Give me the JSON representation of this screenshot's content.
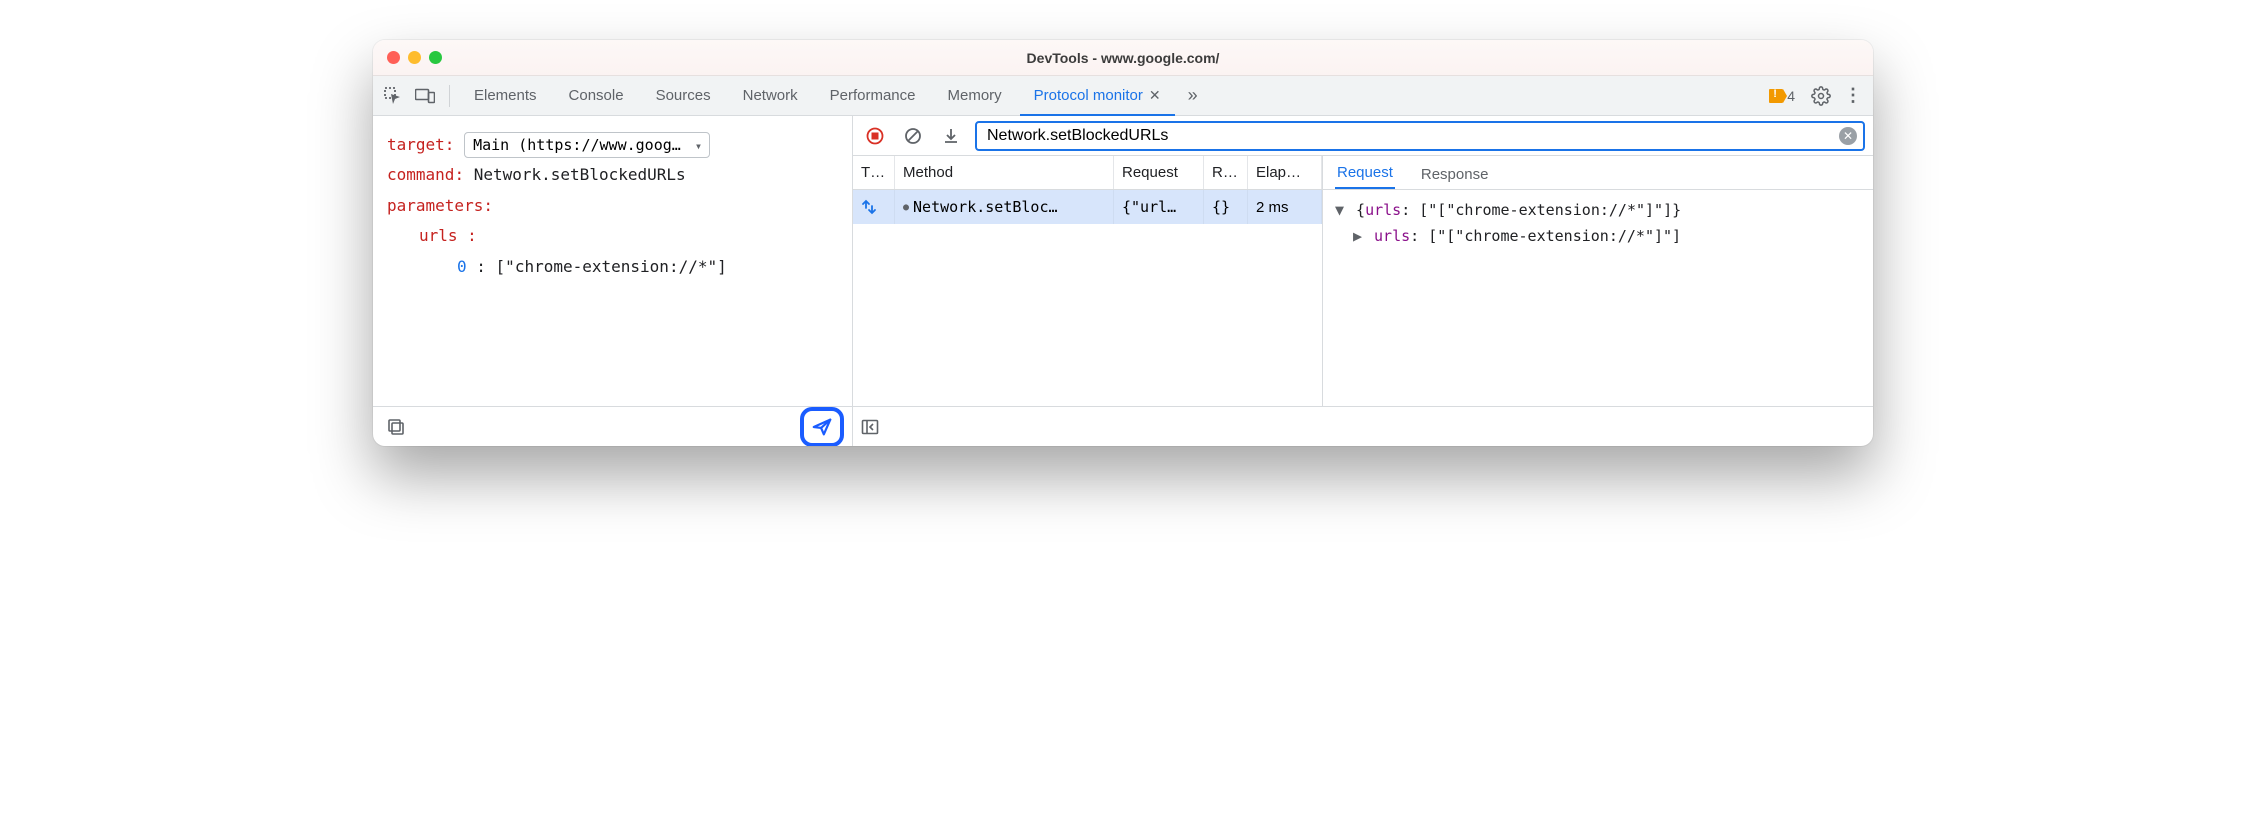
{
  "window": {
    "title": "DevTools - www.google.com/"
  },
  "tabs": {
    "items": [
      "Elements",
      "Console",
      "Sources",
      "Network",
      "Performance",
      "Memory",
      "Protocol monitor"
    ],
    "active_index": 6,
    "warning_count": "4"
  },
  "editor": {
    "target_label": "target",
    "target_value": "Main (https://www.goog…",
    "command_label": "command",
    "command_value": "Network.setBlockedURLs",
    "parameters_label": "parameters",
    "param_name": "urls",
    "param_index": "0",
    "param_value": "[\"chrome-extension://*\"]"
  },
  "filter": {
    "value": "Network.setBlockedURLs"
  },
  "table": {
    "headers": {
      "type": "T…",
      "method": "Method",
      "request": "Request",
      "response": "R…",
      "elapsed": "Elap…"
    },
    "rows": [
      {
        "method": "Network.setBloc…",
        "request": "{\"url…",
        "response": "{}",
        "elapsed": "2 ms"
      }
    ]
  },
  "detail": {
    "tabs": {
      "request": "Request",
      "response": "Response",
      "active": "request"
    },
    "line1_prop": "urls",
    "line1_text": "{urls: [\"[\"chrome-extension://*\"]\"]}",
    "line2_prop": "urls",
    "line2_val": "[\"[\"chrome-extension://*\"]\"]"
  }
}
